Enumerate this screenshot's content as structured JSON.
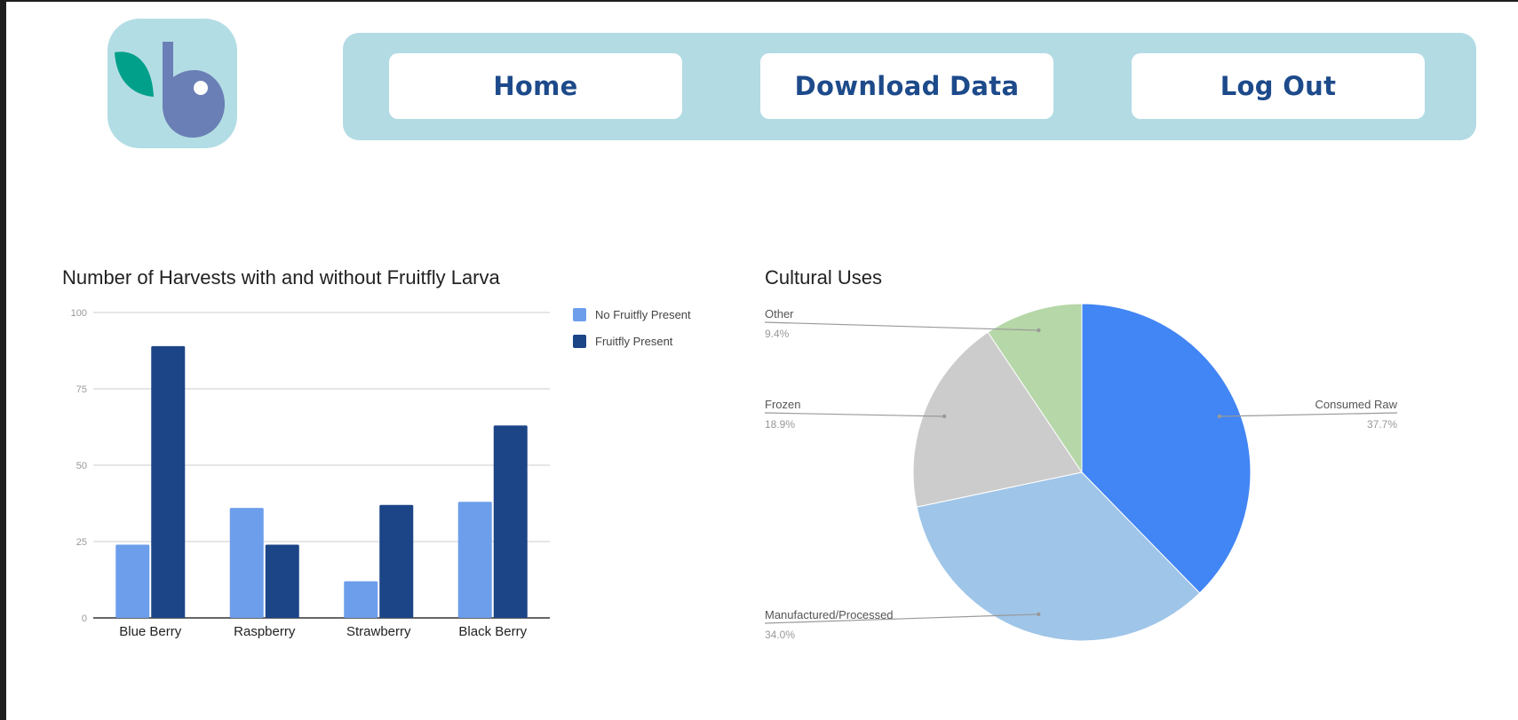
{
  "brand": {
    "logo_icon": "leaf-b-logo",
    "colors": {
      "logo_bg": "#b3dde4",
      "leaf": "#00a08a",
      "letter": "#6a7fb5"
    }
  },
  "nav": {
    "home_label": "Home",
    "download_label": "Download Data",
    "logout_label": "Log Out"
  },
  "bar_chart": {
    "title": "Number of Harvests with and without Fruitfly Larva"
  },
  "pie_chart": {
    "title": "Cultural Uses"
  },
  "chart_data": [
    {
      "type": "bar",
      "title": "Number of Harvests with and without Fruitfly Larva",
      "categories": [
        "Blue Berry",
        "Raspberry",
        "Strawberry",
        "Black Berry"
      ],
      "series": [
        {
          "name": "No Fruitfly Present",
          "values": [
            24,
            36,
            12,
            38
          ],
          "color": "#6d9eeb"
        },
        {
          "name": "Fruitfly Present",
          "values": [
            89,
            24,
            37,
            63
          ],
          "color": "#1c4587"
        }
      ],
      "ylim": [
        0,
        100
      ],
      "yticks": [
        "0",
        "25",
        "50",
        "75",
        "100"
      ],
      "grid": true,
      "legend": "right"
    },
    {
      "type": "pie",
      "title": "Cultural Uses",
      "slices": [
        {
          "label": "Consumed Raw",
          "value": 37.7,
          "pct": "37.7%",
          "color": "#4285f4",
          "side": "right"
        },
        {
          "label": "Manufactured/Processed",
          "value": 34.0,
          "pct": "34.0%",
          "color": "#9fc5e8",
          "side": "left"
        },
        {
          "label": "Frozen",
          "value": 18.9,
          "pct": "18.9%",
          "color": "#cccccc",
          "side": "left"
        },
        {
          "label": "Other",
          "value": 9.4,
          "pct": "9.4%",
          "color": "#b6d7a8",
          "side": "left"
        }
      ]
    }
  ]
}
